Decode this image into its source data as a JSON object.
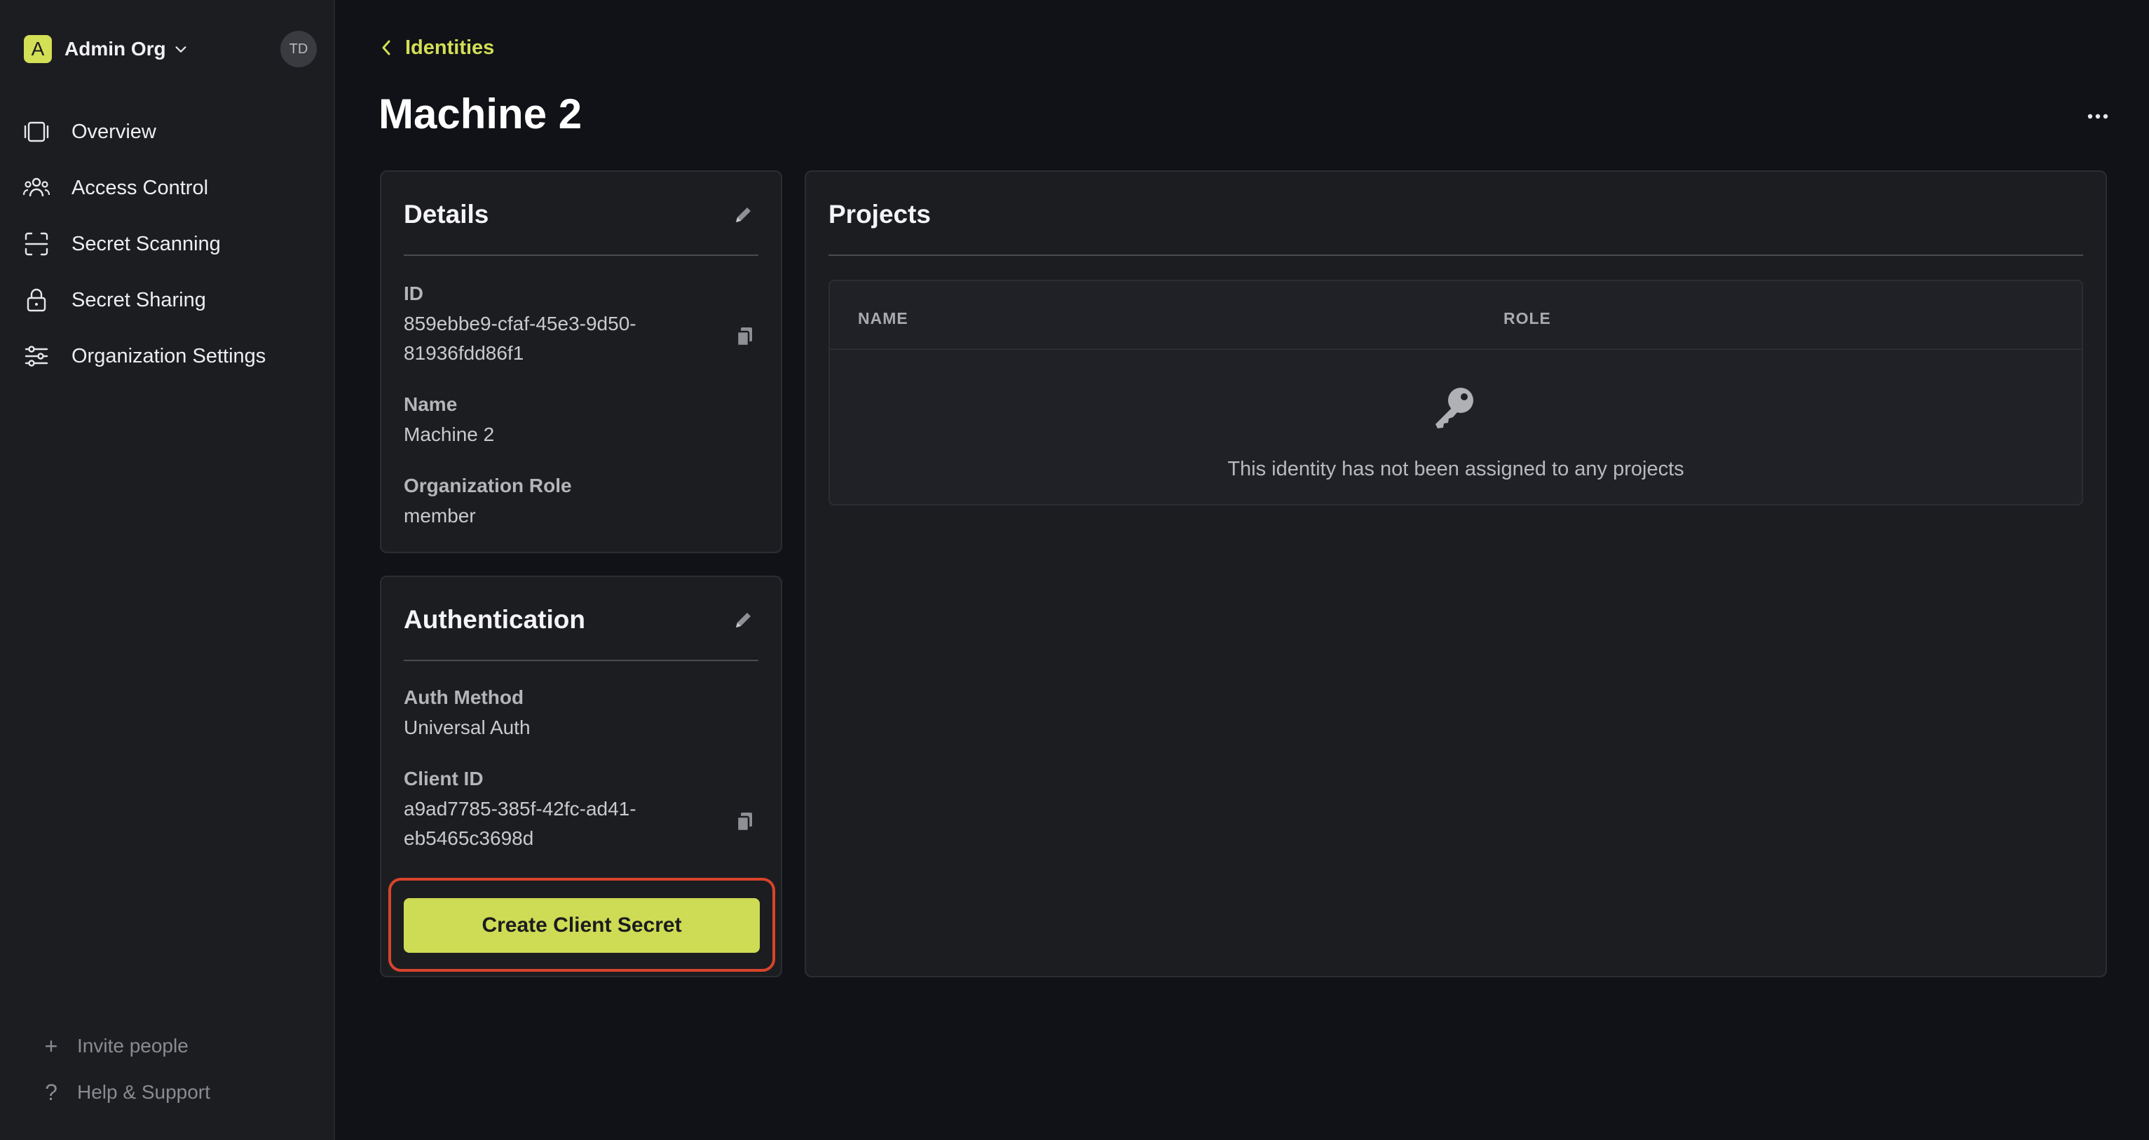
{
  "sidebar": {
    "org_initial": "A",
    "org_name": "Admin Org",
    "avatar_initials": "TD",
    "items": [
      {
        "label": "Overview",
        "icon": "overview-icon"
      },
      {
        "label": "Access Control",
        "icon": "users-icon"
      },
      {
        "label": "Secret Scanning",
        "icon": "scan-icon"
      },
      {
        "label": "Secret Sharing",
        "icon": "lock-icon"
      },
      {
        "label": "Organization Settings",
        "icon": "sliders-icon"
      }
    ],
    "bottom": [
      {
        "label": "Invite people",
        "icon": "plus-icon"
      },
      {
        "label": "Help & Support",
        "icon": "question-icon"
      }
    ]
  },
  "header": {
    "back_label": "Identities",
    "title": "Machine 2"
  },
  "details": {
    "title": "Details",
    "id_label": "ID",
    "id_value_line1": "859ebbe9-cfaf-45e3-9d50-",
    "id_value_line2": "81936fdd86f1",
    "name_label": "Name",
    "name_value": "Machine 2",
    "role_label": "Organization Role",
    "role_value": "member"
  },
  "authentication": {
    "title": "Authentication",
    "method_label": "Auth Method",
    "method_value": "Universal Auth",
    "client_id_label": "Client ID",
    "client_id_line1": "a9ad7785-385f-42fc-ad41-",
    "client_id_line2": "eb5465c3698d",
    "create_secret_label": "Create Client Secret"
  },
  "projects": {
    "title": "Projects",
    "columns": [
      "NAME",
      "ROLE"
    ],
    "empty_message": "This identity has not been assigned to any projects"
  },
  "colors": {
    "accent": "#d3df55",
    "background": "#111217",
    "panel": "#1c1d21",
    "highlight": "#d8442b"
  }
}
